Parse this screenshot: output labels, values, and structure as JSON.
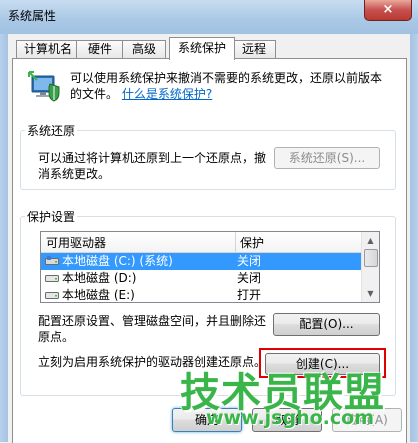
{
  "window": {
    "title": "系统属性",
    "close_glyph": "×"
  },
  "tabs": [
    {
      "label": "计算机名"
    },
    {
      "label": "硬件"
    },
    {
      "label": "高级"
    },
    {
      "label": "系统保护",
      "active": true
    },
    {
      "label": "远程"
    }
  ],
  "intro": {
    "text": "可以使用系统保护来撤消不需要的系统更改，还原以前版本的文件。",
    "link": "什么是系统保护?"
  },
  "restore": {
    "group_label": "系统还原",
    "description": "可以通过将计算机还原到上一个还原点，撤消系统更改。",
    "button": "系统还原(S)..."
  },
  "protection": {
    "group_label": "保护设置",
    "columns": [
      "可用驱动器",
      "保护"
    ],
    "rows": [
      {
        "name": "本地磁盘 (C:) (系统)",
        "protection": "关闭",
        "selected": true
      },
      {
        "name": "本地磁盘 (D:)",
        "protection": "关闭",
        "selected": false
      },
      {
        "name": "本地磁盘 (E:)",
        "protection": "打开",
        "selected": false
      }
    ],
    "configure_text": "配置还原设置、管理磁盘空间，并且删除还原点。",
    "configure_button": "配置(O)...",
    "create_text": "立刻为启用系统保护的驱动器创建还原点。",
    "create_button": "创建(C)..."
  },
  "footer": {
    "ok": "确定",
    "cancel": "取消",
    "apply": "应用(A)"
  },
  "watermark": {
    "text": "技术员联盟",
    "url": "www.jsgho.com"
  },
  "colors": {
    "selection": "#3399ff",
    "link": "#0066cc",
    "highlight": "#e00000",
    "watermark": "#39b54a"
  },
  "icons": {
    "intro": "shield-computer-icon",
    "drive": "drive-icon"
  }
}
